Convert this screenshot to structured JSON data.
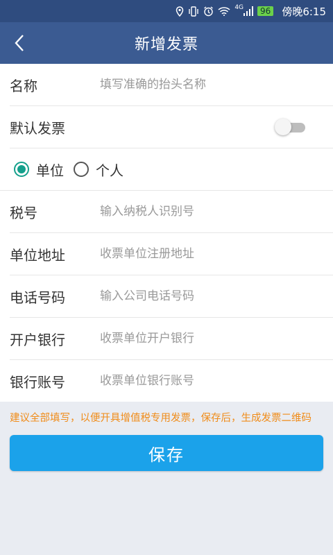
{
  "status_bar": {
    "icons": [
      "location-icon",
      "vibrate-icon",
      "alarm-icon",
      "wifi-icon",
      "signal-icon"
    ],
    "network": "4G",
    "battery": "96",
    "time": "傍晚6:15"
  },
  "header": {
    "title": "新增发票"
  },
  "form": {
    "name": {
      "label": "名称",
      "placeholder": "填写准确的抬头名称"
    },
    "default_invoice": {
      "label": "默认发票",
      "on": false
    },
    "type": {
      "options": [
        "单位",
        "个人"
      ],
      "selected": "单位"
    },
    "tax_no": {
      "label": "税号",
      "placeholder": "输入纳税人识别号"
    },
    "address": {
      "label": "单位地址",
      "placeholder": "收票单位注册地址"
    },
    "phone": {
      "label": "电话号码",
      "placeholder": "输入公司电话号码"
    },
    "bank": {
      "label": "开户银行",
      "placeholder": "收票单位开户银行"
    },
    "account": {
      "label": "银行账号",
      "placeholder": "收票单位银行账号"
    }
  },
  "notice": "建议全部填写，以便开具增值税专用发票，保存后，生成发票二维码",
  "save_label": "保存",
  "colors": {
    "status_bar": "#2f4c7f",
    "header": "#3b5b92",
    "accent": "#15a08c",
    "notice": "#f08c1a",
    "button": "#1ba2ea"
  }
}
